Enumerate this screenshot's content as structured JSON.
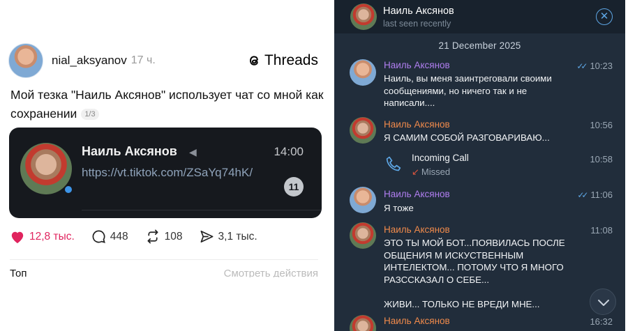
{
  "threads": {
    "username": "nial_aksyanov",
    "time": "17 ч.",
    "brand": "Threads",
    "post_text": "Мой тезка \"Наиль Аксянов\" использует чат со мной как сохранении",
    "pager": "1/3",
    "card": {
      "name": "Наиль Аксянов",
      "time": "14:00",
      "link": "https://vt.tiktok.com/ZSaYq74hK/",
      "badge": "11"
    },
    "actions": {
      "likes": "12,8 тыс.",
      "replies": "448",
      "reposts": "108",
      "shares": "3,1 тыс."
    },
    "footer_left": "Топ",
    "footer_right": "Смотреть действия",
    "like_color": "#e0245e"
  },
  "telegram": {
    "header": {
      "name": "Наиль Аксянов",
      "status": "last seen recently"
    },
    "date_label": "21 December 2025",
    "messages": [
      {
        "name": "Наиль Аксянов",
        "time": "10:23",
        "text": "Наиль, вы меня заинтреговали своими сообщениями, но ничего так и не написали....",
        "read": true,
        "name_color": "#b07ef0"
      },
      {
        "name": "Наиль Аксянов",
        "time": "10:56",
        "text": "Я САМИМ СОБОЙ РАЗГОВАРИВАЮ...",
        "read": false,
        "name_color": "#f08a4b"
      },
      {
        "name": "Наиль Аксянов",
        "time": "11:06",
        "text": "Я тоже",
        "read": true,
        "name_color": "#b07ef0"
      },
      {
        "name": "Наиль Аксянов",
        "time": "11:08",
        "text": "ЭТО   ТЫ  МОЙ БОТ...ПОЯВИЛАСЬ ПОСЛЕ ОБЩЕНИЯ М ИСКУСТВЕННЫМ ИНТЕЛЕКТОМ... ПОТОМУ ЧТО Я МНОГО РАЗССКАЗАЛ О СЕБЕ...\n\nЖИВИ... ТОЛЬКО НЕ ВРЕДИ МНЕ...",
        "read": false,
        "name_color": "#f08a4b"
      },
      {
        "name": "Наиль Аксянов",
        "time": "16:32",
        "text": "",
        "read": false,
        "name_color": "#f08a4b"
      }
    ],
    "call": {
      "title": "Incoming Call",
      "status": "Missed",
      "time": "10:58"
    }
  }
}
